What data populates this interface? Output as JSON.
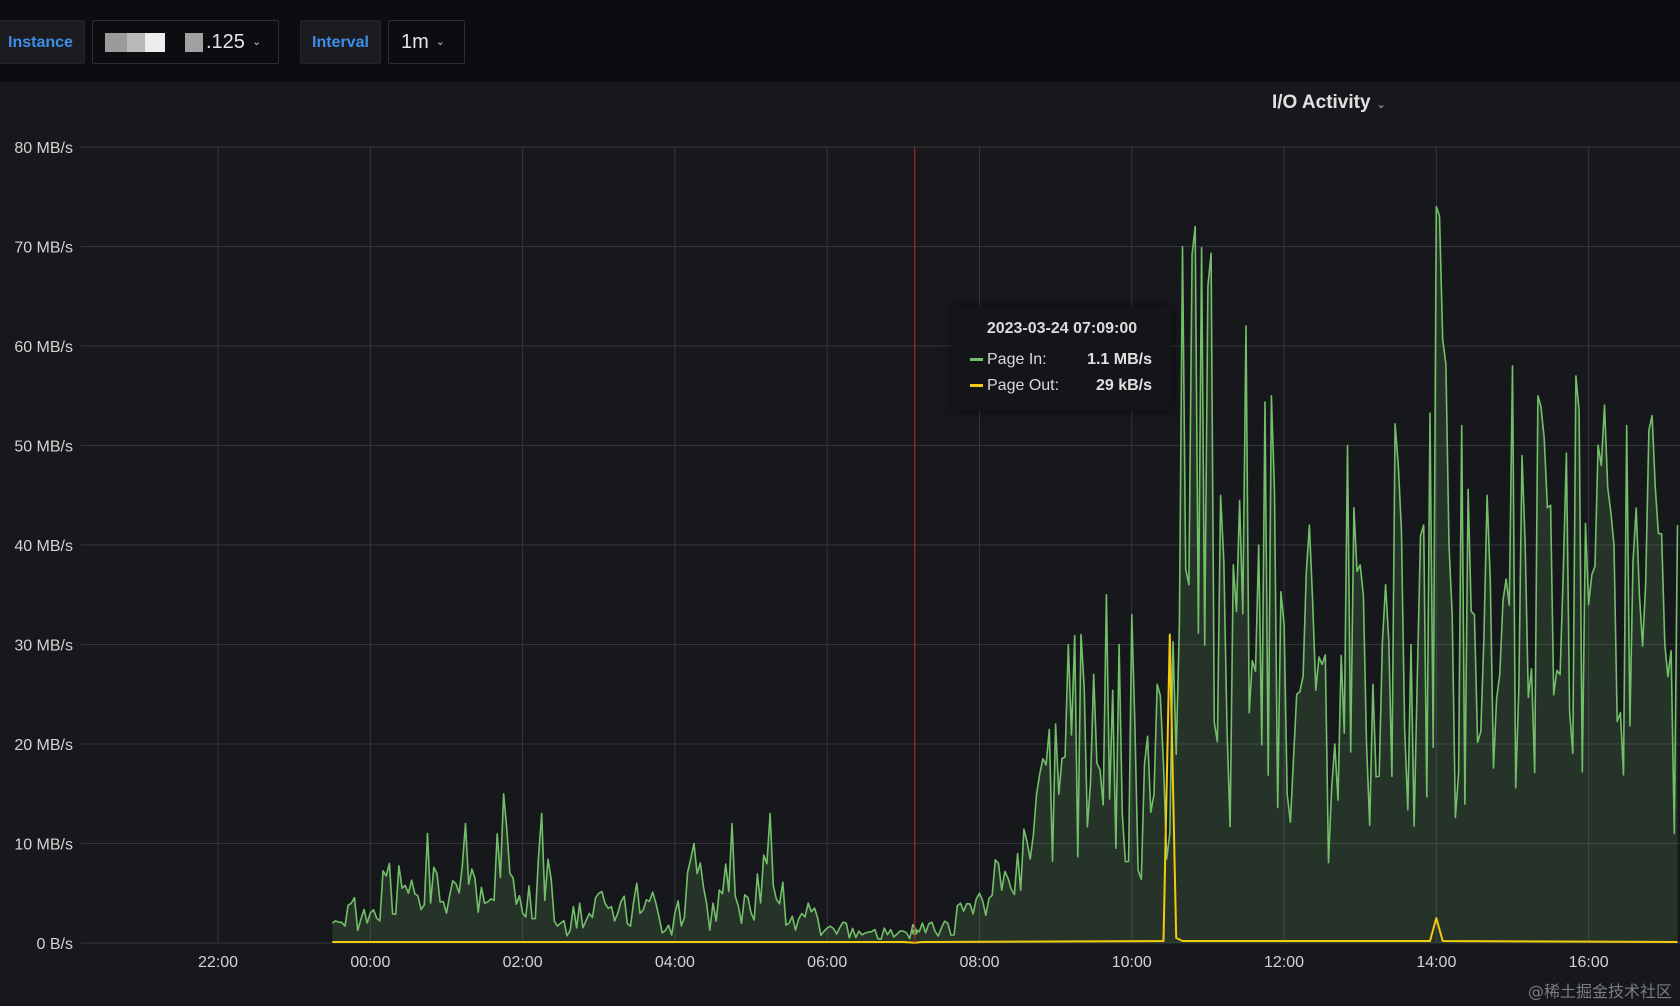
{
  "toolbar": {
    "instance_label": "Instance",
    "instance_value": ".125",
    "interval_label": "Interval",
    "interval_value": "1m"
  },
  "panel": {
    "title": "I/O Activity"
  },
  "tooltip": {
    "time": "2023-03-24 07:09:00",
    "rows": [
      {
        "name": "Page In:",
        "value": "1.1 MB/s",
        "color": "#73bf69"
      },
      {
        "name": "Page Out:",
        "value": "29 kB/s",
        "color": "#f2cc0c"
      }
    ]
  },
  "watermark": "@稀土掘金技术社区",
  "chart_data": {
    "type": "area",
    "title": "I/O Activity",
    "xlabel": "",
    "ylabel": "",
    "x_ticks": [
      "22:00",
      "00:00",
      "02:00",
      "04:00",
      "06:00",
      "08:00",
      "10:00",
      "12:00",
      "14:00",
      "16:00"
    ],
    "y_ticks": [
      "0 B/s",
      "10 MB/s",
      "20 MB/s",
      "30 MB/s",
      "40 MB/s",
      "50 MB/s",
      "60 MB/s",
      "70 MB/s",
      "80 MB/s"
    ],
    "ylim": [
      0,
      80
    ],
    "xlim_hours": [
      20.2,
      17.2
    ],
    "grid": true,
    "crosshair_time": "07:09",
    "series": [
      {
        "name": "Page In",
        "color": "#73bf69",
        "unit": "MB/s",
        "time": [
          "23:30",
          "23:45",
          "00:00",
          "00:15",
          "00:30",
          "00:45",
          "01:00",
          "01:15",
          "01:30",
          "01:45",
          "02:00",
          "02:15",
          "02:30",
          "02:45",
          "03:00",
          "03:15",
          "03:30",
          "03:45",
          "04:00",
          "04:15",
          "04:30",
          "04:45",
          "05:00",
          "05:15",
          "05:30",
          "05:45",
          "06:00",
          "06:15",
          "06:30",
          "06:45",
          "07:00",
          "07:15",
          "07:30",
          "07:45",
          "08:00",
          "08:15",
          "08:30",
          "08:45",
          "09:00",
          "09:10",
          "09:20",
          "09:30",
          "09:40",
          "09:50",
          "10:00",
          "10:10",
          "10:20",
          "10:30",
          "10:40",
          "10:50",
          "11:00",
          "11:10",
          "11:20",
          "11:30",
          "11:40",
          "11:50",
          "12:00",
          "12:10",
          "12:20",
          "12:30",
          "12:40",
          "12:50",
          "13:00",
          "13:10",
          "13:20",
          "13:30",
          "13:40",
          "13:50",
          "14:00",
          "14:10",
          "14:20",
          "14:30",
          "14:40",
          "14:50",
          "15:00",
          "15:10",
          "15:20",
          "15:30",
          "15:40",
          "15:50",
          "16:00",
          "16:10",
          "16:20",
          "16:30",
          "16:40",
          "16:50",
          "17:00",
          "17:10"
        ],
        "values": [
          2,
          4,
          3,
          8,
          5,
          11,
          3,
          12,
          4,
          15,
          3,
          13,
          2,
          4,
          5,
          3,
          6,
          4,
          3,
          10,
          4,
          12,
          3,
          13,
          2,
          4,
          1.5,
          2,
          1,
          1.5,
          1.2,
          2,
          1.5,
          4,
          5,
          8,
          9,
          15,
          22,
          30,
          31,
          27,
          35,
          30,
          33,
          18,
          26,
          11,
          70,
          72,
          66,
          45,
          38,
          62,
          40,
          55,
          32,
          25,
          42,
          28,
          20,
          50,
          38,
          26,
          36,
          48,
          30,
          42,
          74,
          40,
          52,
          33,
          45,
          27,
          58,
          40,
          55,
          44,
          37,
          57,
          34,
          48,
          40,
          52,
          35,
          53,
          30,
          42
        ]
      },
      {
        "name": "Page Out",
        "color": "#f2cc0c",
        "unit": "MB/s",
        "time": [
          "23:30",
          "07:00",
          "07:09",
          "07:15",
          "10:25",
          "10:30",
          "10:35",
          "10:40",
          "13:55",
          "14:00",
          "14:05",
          "17:10"
        ],
        "values": [
          0.1,
          0.1,
          0.03,
          0.1,
          0.2,
          31,
          0.5,
          0.2,
          0.2,
          2.5,
          0.2,
          0.1
        ]
      }
    ]
  }
}
